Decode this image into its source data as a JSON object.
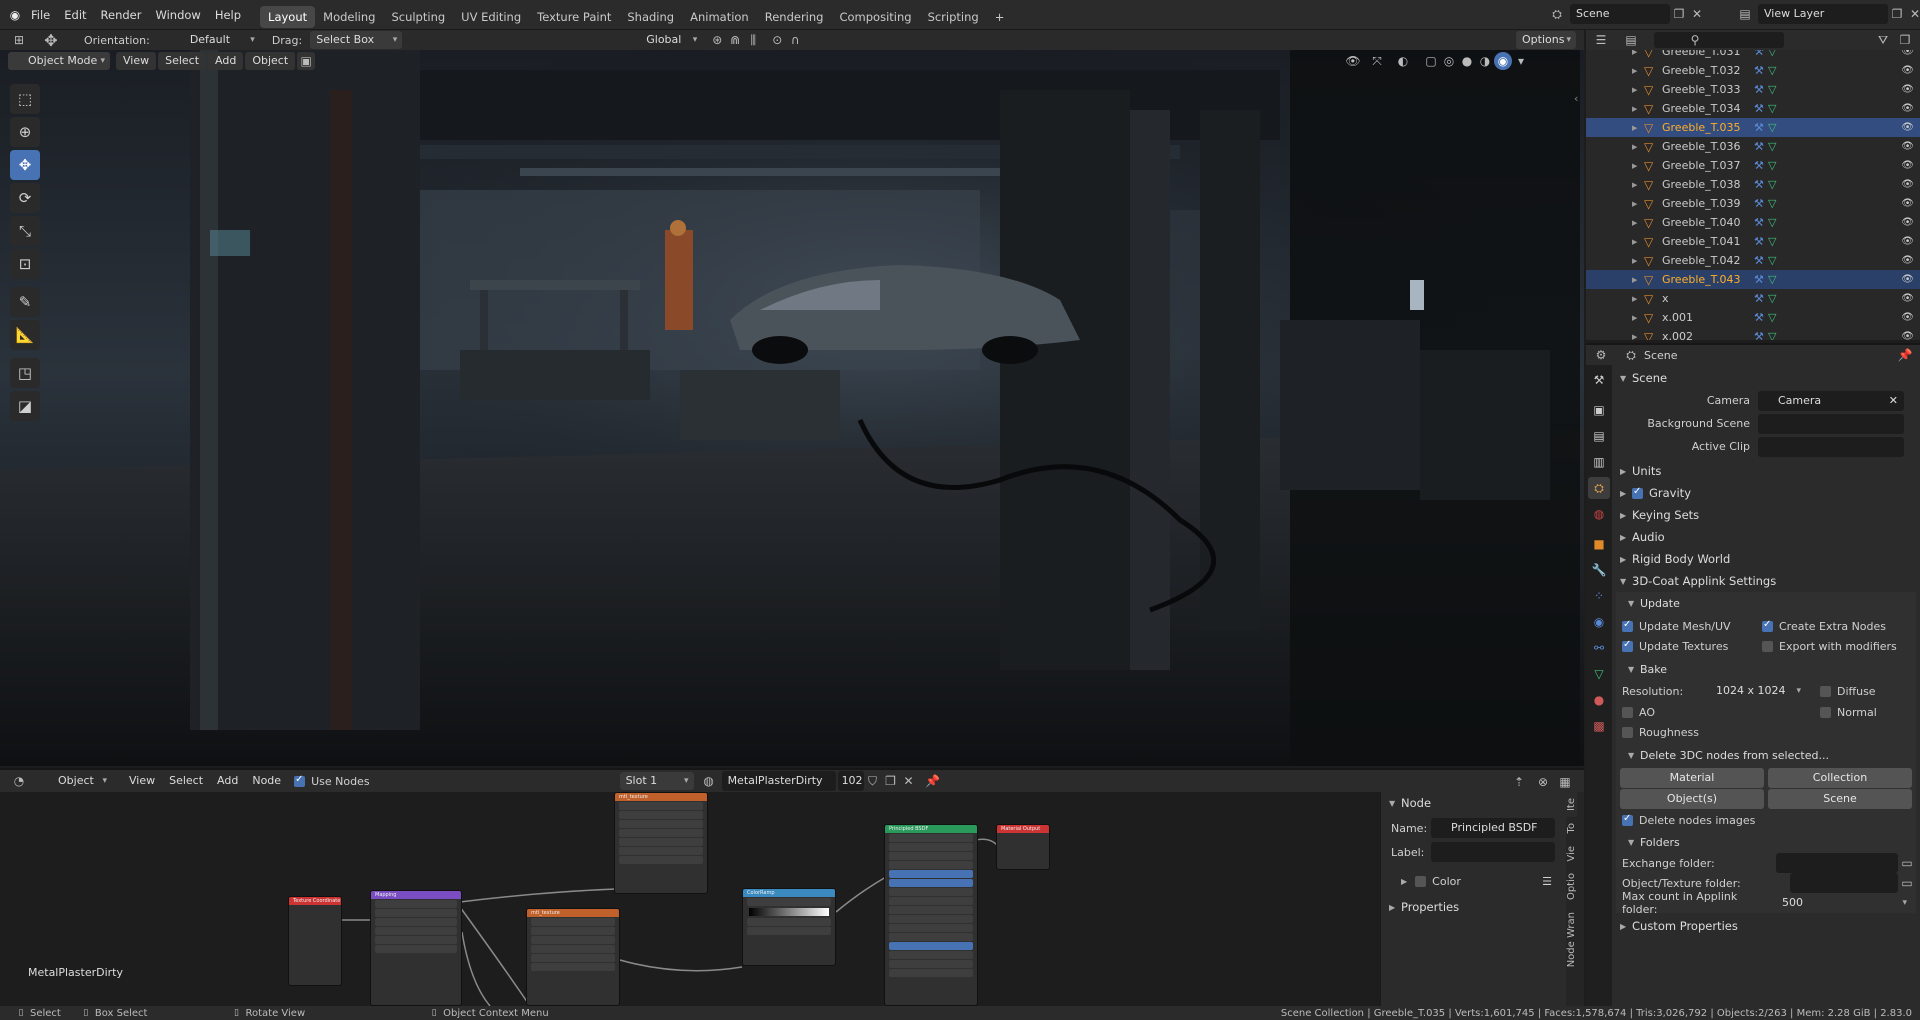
{
  "topbar": {
    "menus": [
      "File",
      "Edit",
      "Render",
      "Window",
      "Help"
    ],
    "workspaces": [
      "Layout",
      "Modeling",
      "Sculpting",
      "UV Editing",
      "Texture Paint",
      "Shading",
      "Animation",
      "Rendering",
      "Compositing",
      "Scripting"
    ],
    "active_workspace": "Layout",
    "add_tab": "+",
    "scene": "Scene",
    "view_layer": "View Layer"
  },
  "viewport": {
    "orientation_label": "Orientation:",
    "orientation_value": "Default",
    "drag_label": "Drag:",
    "drag_value": "Select Box",
    "transform_orientation": "Global",
    "options": "Options",
    "mode": "Object Mode",
    "menus": [
      "View",
      "Select",
      "Add",
      "Object"
    ]
  },
  "node_editor": {
    "type": "Object",
    "menus": [
      "View",
      "Select",
      "Add",
      "Node"
    ],
    "use_nodes_label": "Use Nodes",
    "slot": "Slot 1",
    "material": "MetalPlasterDirty",
    "users": "102",
    "material_label": "MetalPlasterDirty",
    "nodes": {
      "texcoord": "Texture Coordinate",
      "mapping": "Mapping",
      "image1": "mtl_texture",
      "image2": "mtl_texture",
      "colorramp": "ColorRamp",
      "bsdf": "Principled BSDF",
      "output": "Material Output"
    },
    "panel": {
      "section": "Node",
      "name_label": "Name:",
      "name_value": "Principled BSDF",
      "label_label": "Label:",
      "color_label": "Color",
      "properties_label": "Properties"
    },
    "tabs": [
      "Ite",
      "To",
      "Vie",
      "Optio",
      "Node Wran"
    ]
  },
  "outliner": {
    "items": [
      {
        "name": "Greeble_T.031",
        "state": "normal"
      },
      {
        "name": "Greeble_T.032",
        "state": "normal"
      },
      {
        "name": "Greeble_T.033",
        "state": "normal"
      },
      {
        "name": "Greeble_T.034",
        "state": "normal"
      },
      {
        "name": "Greeble_T.035",
        "state": "active"
      },
      {
        "name": "Greeble_T.036",
        "state": "normal"
      },
      {
        "name": "Greeble_T.037",
        "state": "normal"
      },
      {
        "name": "Greeble_T.038",
        "state": "normal"
      },
      {
        "name": "Greeble_T.039",
        "state": "normal"
      },
      {
        "name": "Greeble_T.040",
        "state": "normal"
      },
      {
        "name": "Greeble_T.041",
        "state": "normal"
      },
      {
        "name": "Greeble_T.042",
        "state": "normal"
      },
      {
        "name": "Greeble_T.043",
        "state": "selected"
      },
      {
        "name": "x",
        "state": "normal"
      },
      {
        "name": "x.001",
        "state": "normal"
      },
      {
        "name": "x.002",
        "state": "normal"
      }
    ]
  },
  "properties": {
    "breadcrumb": "Scene",
    "scene_section": "Scene",
    "camera_label": "Camera",
    "camera_value": "Camera",
    "background_scene_label": "Background Scene",
    "active_clip_label": "Active Clip",
    "units": "Units",
    "gravity": "Gravity",
    "keying_sets": "Keying Sets",
    "audio": "Audio",
    "rigid_body_world": "Rigid Body World",
    "applink": "3D-Coat Applink Settings",
    "update": "Update",
    "update_mesh_uv": "Update Mesh/UV",
    "create_extra_nodes": "Create Extra Nodes",
    "update_textures": "Update Textures",
    "export_with_modifiers": "Export with modifiers",
    "bake": "Bake",
    "resolution_label": "Resolution:",
    "resolution_value": "1024 x 1024",
    "diffuse": "Diffuse",
    "ao": "AO",
    "normal": "Normal",
    "roughness": "Roughness",
    "delete_nodes": "Delete 3DC nodes from selected...",
    "material_btn": "Material",
    "collection_btn": "Collection",
    "objects_btn": "Object(s)",
    "scene_btn": "Scene",
    "delete_nodes_images": "Delete nodes images",
    "folders": "Folders",
    "exchange_folder": "Exchange folder:",
    "object_texture_folder": "Object/Texture folder:",
    "max_count_label": "Max count in Applink folder:",
    "max_count_value": "500",
    "custom_properties": "Custom Properties"
  },
  "statusbar": {
    "select": "Select",
    "box_select": "Box Select",
    "rotate_view": "Rotate View",
    "context_menu": "Object Context Menu",
    "stats": "Scene Collection | Greeble_T.035 | Verts:1,601,745 | Faces:1,578,674 | Tris:3,026,792 | Objects:2/263 | Mem: 2.28 GiB | 2.83.0"
  },
  "colors": {
    "accent": "#4772b3",
    "active_text": "#ffaf29",
    "selected_row": "#334d80"
  }
}
